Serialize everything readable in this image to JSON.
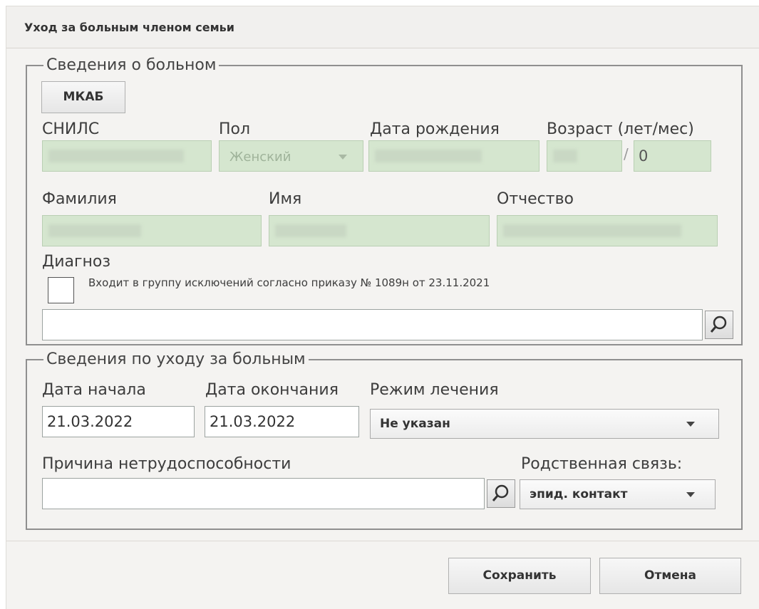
{
  "dialog": {
    "title": "Уход за больным членом семьи"
  },
  "patient": {
    "legend": "Сведения о больном",
    "mkab_button": "МКАБ",
    "snils_label": "СНИЛС",
    "gender_label": "Пол",
    "gender_value": "Женский",
    "birthdate_label": "Дата рождения",
    "age_label": "Возраст (лет/мес)",
    "age_separator": "/",
    "age_months": "0",
    "lastname_label": "Фамилия",
    "firstname_label": "Имя",
    "patronymic_label": "Отчество",
    "diagnosis_label": "Диагноз",
    "exclusion_checkbox_label": "Входит в группу исключений согласно приказу № 1089н от 23.11.2021",
    "exclusion_checked": false,
    "diagnosis_value": ""
  },
  "care": {
    "legend": "Сведения по уходу за больным",
    "start_label": "Дата начала",
    "start_value": "21.03.2022",
    "end_label": "Дата окончания",
    "end_value": "21.03.2022",
    "mode_label": "Режим лечения",
    "mode_value": "Не указан",
    "reason_label": "Причина нетрудоспособности",
    "reason_value": "",
    "relation_label": "Родственная связь:",
    "relation_value": "эпид. контакт"
  },
  "footer": {
    "save_label": "Сохранить",
    "cancel_label": "Отмена"
  },
  "colors": {
    "disabled_field": "#d5e6cf",
    "dialog_bg": "#f4f3f1",
    "border": "#8f8f8f"
  },
  "icons": {
    "search": "magnifier-icon",
    "dropdown": "chevron-down-icon"
  }
}
